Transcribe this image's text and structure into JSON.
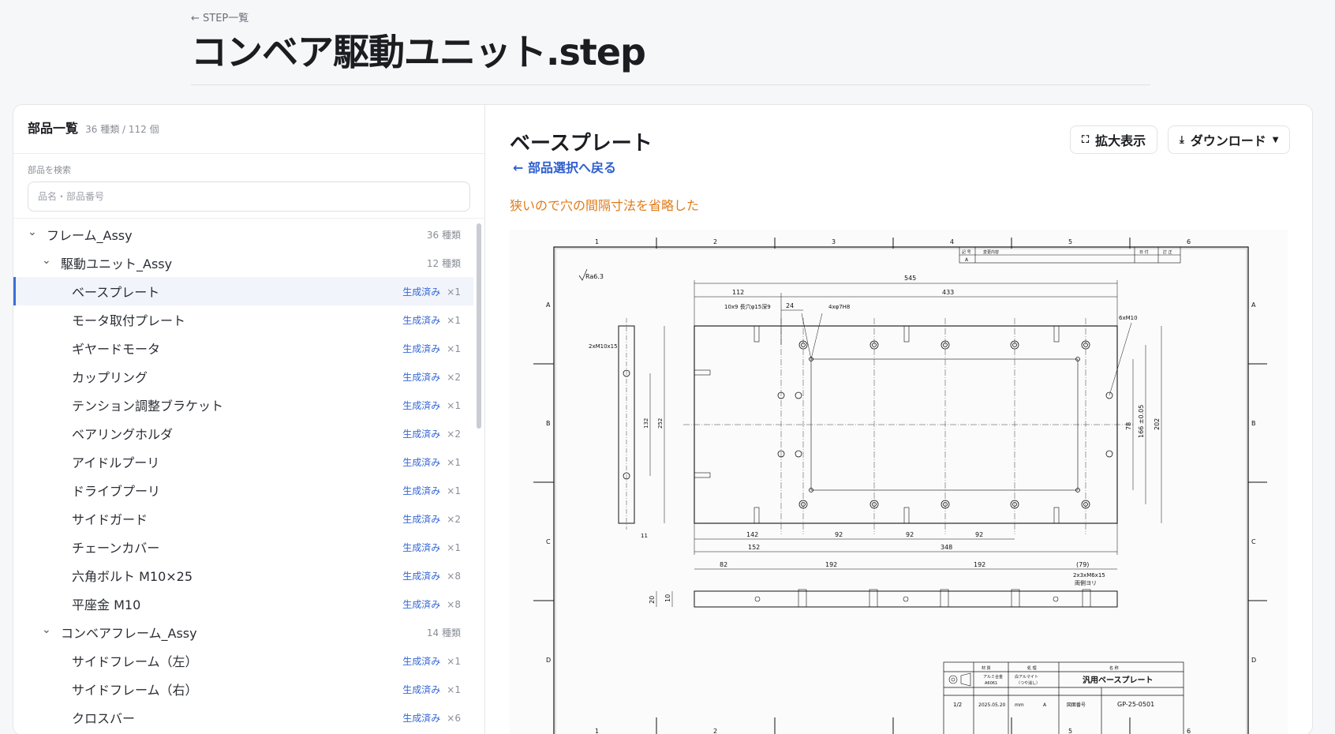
{
  "header": {
    "back_label": "← STEP一覧",
    "title": "コンベア駆動ユニット.step"
  },
  "sidebar": {
    "title": "部品一覧",
    "count": "36 種類 / 112 個",
    "search_label": "部品を検索",
    "search_placeholder": "品名・部品番号"
  },
  "tree": [
    {
      "level": 0,
      "type": "group",
      "label": "フレーム_Assy",
      "meta": "36 種類"
    },
    {
      "level": 1,
      "type": "group",
      "label": "駆動ユニット_Assy",
      "meta": "12 種類"
    },
    {
      "level": 2,
      "type": "part",
      "label": "ベースプレート",
      "status": "生成済み",
      "qty": "×1",
      "selected": true
    },
    {
      "level": 2,
      "type": "part",
      "label": "モータ取付プレート",
      "status": "生成済み",
      "qty": "×1"
    },
    {
      "level": 2,
      "type": "part",
      "label": "ギヤードモータ",
      "status": "生成済み",
      "qty": "×1"
    },
    {
      "level": 2,
      "type": "part",
      "label": "カップリング",
      "status": "生成済み",
      "qty": "×2"
    },
    {
      "level": 2,
      "type": "part",
      "label": "テンション調整ブラケット",
      "status": "生成済み",
      "qty": "×1"
    },
    {
      "level": 2,
      "type": "part",
      "label": "ベアリングホルダ",
      "status": "生成済み",
      "qty": "×2"
    },
    {
      "level": 2,
      "type": "part",
      "label": "アイドルプーリ",
      "status": "生成済み",
      "qty": "×1"
    },
    {
      "level": 2,
      "type": "part",
      "label": "ドライブプーリ",
      "status": "生成済み",
      "qty": "×1"
    },
    {
      "level": 2,
      "type": "part",
      "label": "サイドガード",
      "status": "生成済み",
      "qty": "×2"
    },
    {
      "level": 2,
      "type": "part",
      "label": "チェーンカバー",
      "status": "生成済み",
      "qty": "×1"
    },
    {
      "level": 2,
      "type": "part",
      "label": "六角ボルト M10×25",
      "status": "生成済み",
      "qty": "×8"
    },
    {
      "level": 2,
      "type": "part",
      "label": "平座金 M10",
      "status": "生成済み",
      "qty": "×8"
    },
    {
      "level": 1,
      "type": "group",
      "label": "コンベアフレーム_Assy",
      "meta": "14 種類"
    },
    {
      "level": 2,
      "type": "part",
      "label": "サイドフレーム（左）",
      "status": "生成済み",
      "qty": "×1"
    },
    {
      "level": 2,
      "type": "part",
      "label": "サイドフレーム（右）",
      "status": "生成済み",
      "qty": "×1"
    },
    {
      "level": 2,
      "type": "part",
      "label": "クロスバー",
      "status": "生成済み",
      "qty": "×6"
    }
  ],
  "detail": {
    "part_name": "ベースプレート",
    "back_label": "← 部品選択へ戻る",
    "note": "狭いので穴の間隔寸法を省略した",
    "zoom_label": "拡大表示",
    "download_label": "ダウンロード",
    "zoom_icon": "expand-icon",
    "download_icon": "download-icon"
  },
  "drawing": {
    "col_labels": [
      "1",
      "2",
      "3",
      "4",
      "5",
      "6"
    ],
    "row_labels": [
      "A",
      "B",
      "C",
      "D"
    ],
    "surface": "Ra6.3",
    "dims": {
      "overall": "545",
      "d112": "112",
      "d433": "433",
      "d24": "24",
      "slot": "10x9 長穴φ15深9",
      "pin": "4xφ7H8",
      "m10_6": "6xM10",
      "m10_2": "2xM10x15",
      "h252": "252",
      "h132": "132",
      "h78": "78",
      "h166": "166 ±0.05",
      "h202": "202",
      "d142": "142",
      "d92a": "92",
      "d92b": "92",
      "d92c": "92",
      "d152": "152",
      "d348": "348",
      "d11": "11",
      "b82": "82",
      "b192a": "192",
      "b192b": "192",
      "b79": "(79)",
      "tap": "2x3xM6x15",
      "tap2": "両側ヨリ",
      "t20": "20",
      "t10": "10"
    },
    "title_block": {
      "material_head": "材 質",
      "material": "アルミ合金",
      "material2": "A6061",
      "treatment_head": "処 理",
      "treatment": "白アルマイト",
      "treatment2": "（つや消し）",
      "name_head": "名 称",
      "name": "汎用ベースプレート",
      "scale": "1/2",
      "date": "2025.05.20",
      "unit": "mm",
      "rev": "A",
      "drawing_no_head": "図面番号",
      "drawing_no": "GP-25-0501"
    },
    "revision_head": [
      "記 号",
      "変更内容",
      "日 付",
      "訂 正"
    ],
    "revision_row": "A"
  }
}
